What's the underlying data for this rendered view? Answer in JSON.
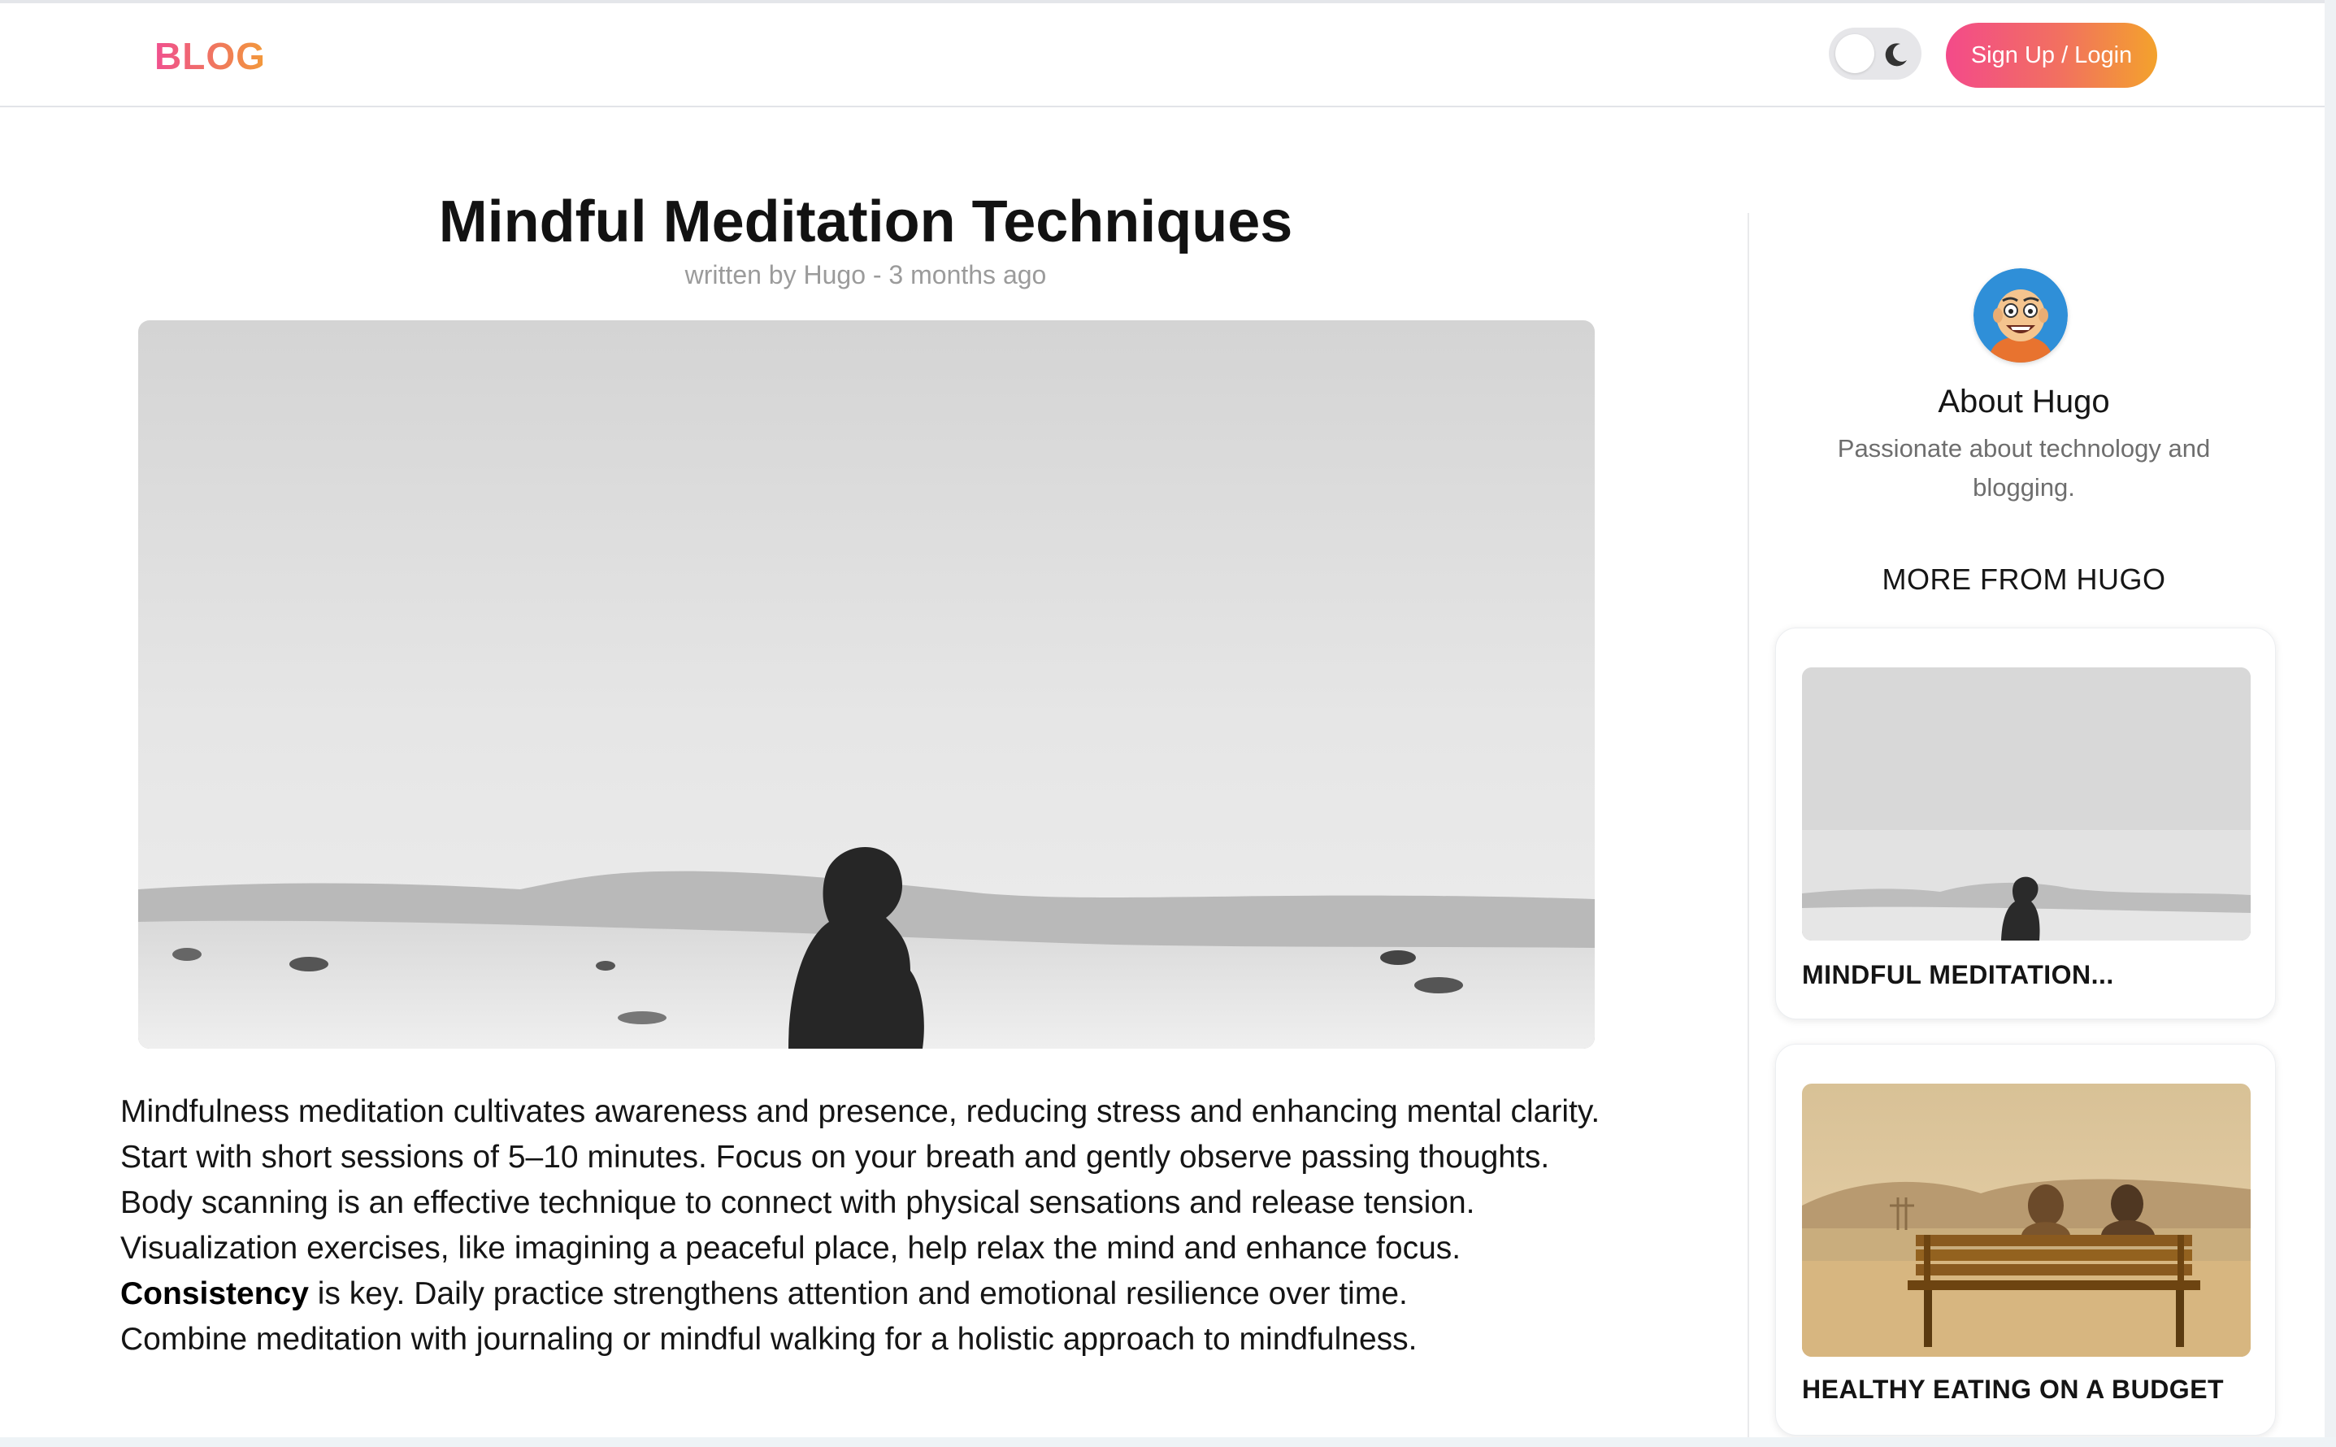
{
  "header": {
    "logo": "BLOG",
    "theme_toggle_icon": "moon-icon",
    "signup_label": "Sign Up / Login",
    "accent_gradient": [
      "#f34a8a",
      "#f2715f",
      "#f3a22c"
    ]
  },
  "article": {
    "title": "Mindful Meditation Techniques",
    "byline": "written by Hugo - 3 months ago",
    "image": "desert-silhouette-photo",
    "paragraphs": [
      "Mindfulness meditation cultivates awareness and presence, reducing stress and enhancing mental clarity.",
      "Start with short sessions of 5–10 minutes. Focus on your breath and gently observe passing thoughts.",
      "Body scanning is an effective technique to connect with physical sensations and release tension.",
      "Visualization exercises, like imagining a peaceful place, help relax the mind and enhance focus."
    ],
    "bold_lead": "Consistency",
    "bold_rest": " is key. Daily practice strengthens attention and emotional resilience over time.",
    "last_paragraph": "Combine meditation with journaling or mindful walking for a holistic approach to mindfulness."
  },
  "sidebar": {
    "avatar": "author-avatar-illustration",
    "about_title": "About Hugo",
    "about_desc": "Passionate about technology and blogging.",
    "more_title": "MORE FROM HUGO",
    "posts": [
      {
        "title": "MINDFUL MEDITATION...",
        "image": "desert-silhouette-photo"
      },
      {
        "title": "HEALTHY EATING ON A BUDGET",
        "image": "couple-on-bench-photo"
      }
    ]
  }
}
